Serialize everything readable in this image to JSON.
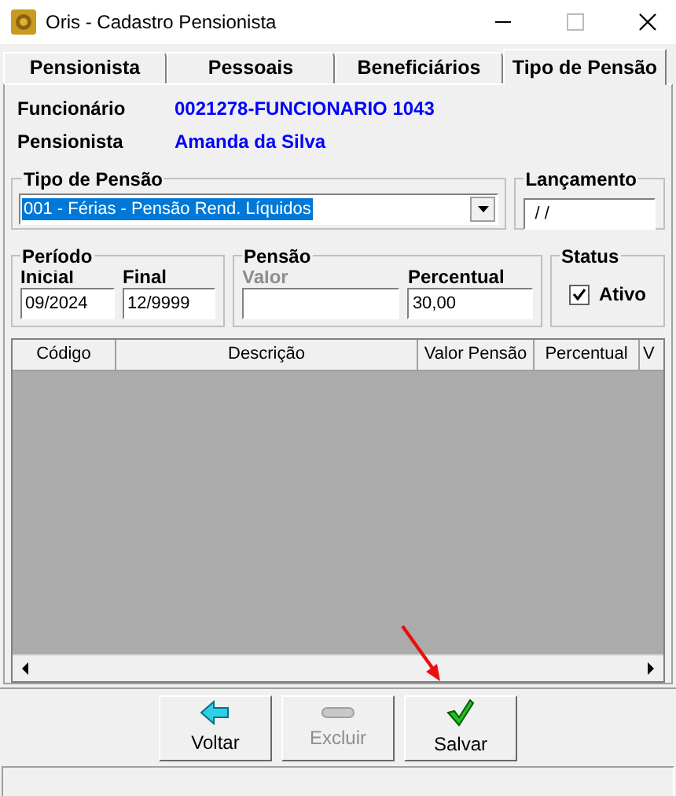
{
  "window": {
    "title": "Oris - Cadastro Pensionista"
  },
  "tabs": [
    {
      "label": "Pensionista",
      "selected": false
    },
    {
      "label": "Pessoais",
      "selected": false
    },
    {
      "label": "Beneficiários",
      "selected": false
    },
    {
      "label": "Tipo de Pensão",
      "selected": true
    }
  ],
  "info": [
    {
      "label": "Funcionário",
      "value": "0021278-FUNCIONARIO 1043"
    },
    {
      "label": "Pensionista",
      "value": "Amanda da Silva"
    }
  ],
  "tipo_pensao": {
    "title": "Tipo de Pensão",
    "value": "001 - Férias - Pensão Rend. Líquidos"
  },
  "lancamento": {
    "title": "Lançamento",
    "value": " / /"
  },
  "periodo": {
    "title": "Período",
    "fields": [
      {
        "label": "Inicial",
        "value": "09/2024",
        "disabled": false
      },
      {
        "label": "Final",
        "value": "12/9999",
        "disabled": false
      }
    ]
  },
  "pensao": {
    "title": "Pensão",
    "fields": [
      {
        "label": "Valor",
        "disabled": true
      },
      {
        "label": "Percentual",
        "value": "30,00",
        "disabled": false
      }
    ]
  },
  "status": {
    "title": "Status",
    "checkbox": {
      "label": "Ativo",
      "checked": true
    }
  },
  "table": {
    "columns": [
      "Código",
      "Descrição",
      "Valor Pensão",
      "Percentual",
      "V"
    ]
  },
  "buttons": [
    {
      "label": "Voltar",
      "kind": "back",
      "disabled": false
    },
    {
      "label": "Excluir",
      "kind": "delete",
      "disabled": true
    },
    {
      "label": "Salvar",
      "kind": "save",
      "disabled": false
    }
  ]
}
